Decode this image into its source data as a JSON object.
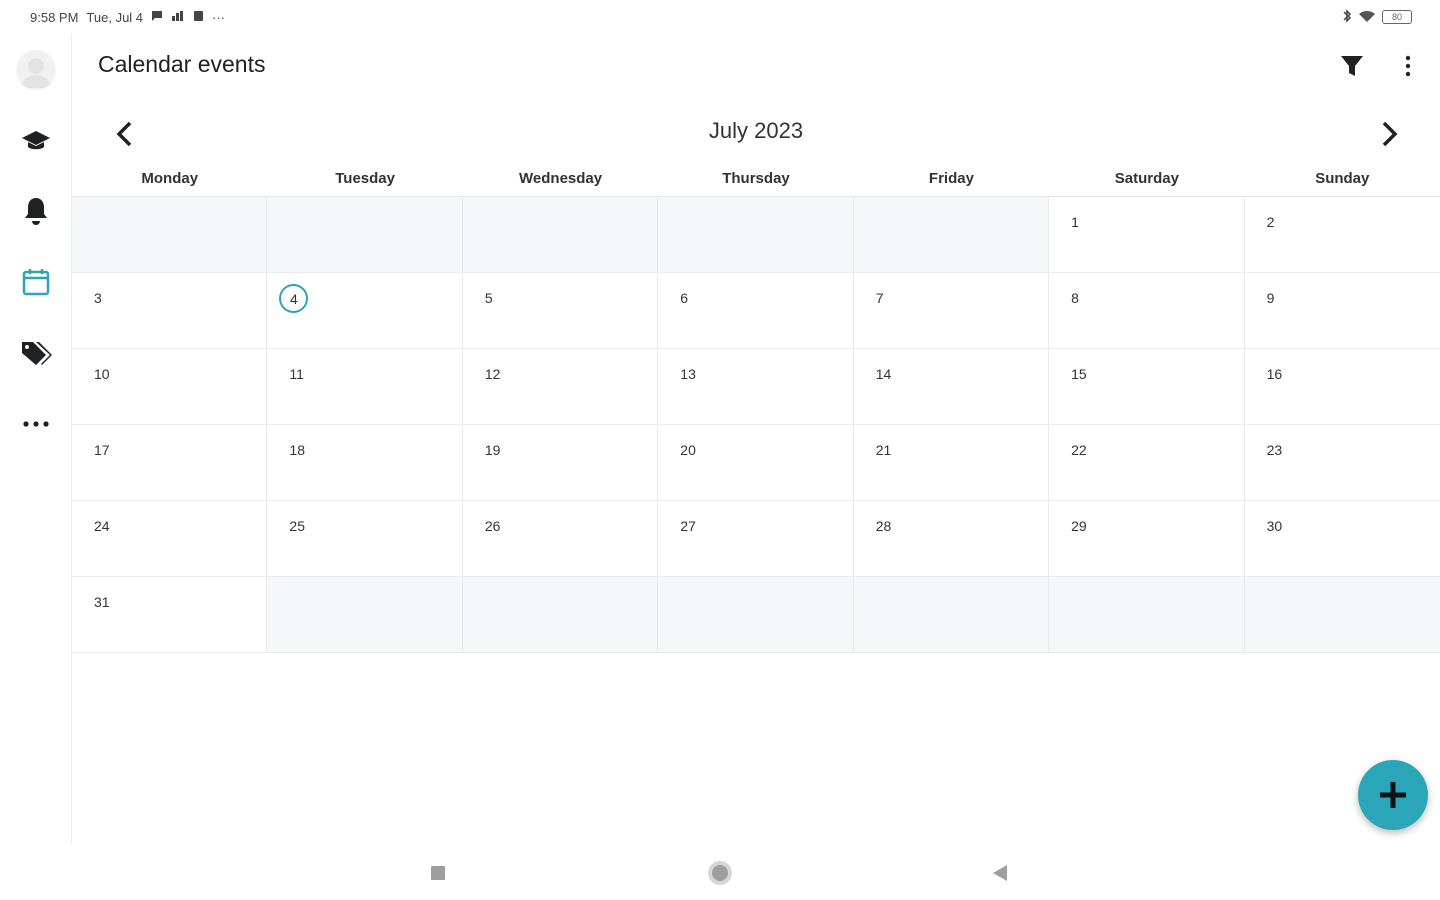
{
  "status_bar": {
    "time": "9:58 PM",
    "date": "Tue, Jul 4",
    "more": "···",
    "battery": "80"
  },
  "app": {
    "title": "Calendar events",
    "accent_color": "#2aa6b8"
  },
  "rail": {
    "items": [
      {
        "icon": "graduation-cap-icon"
      },
      {
        "icon": "bell-icon"
      },
      {
        "icon": "calendar-icon",
        "active": true
      },
      {
        "icon": "tags-icon"
      },
      {
        "icon": "more-horizontal-icon"
      }
    ]
  },
  "header": {
    "filter_icon": "filter-icon",
    "menu_icon": "more-vertical-icon"
  },
  "calendar": {
    "month_label": "July 2023",
    "weekdays": [
      "Monday",
      "Tuesday",
      "Wednesday",
      "Thursday",
      "Friday",
      "Saturday",
      "Sunday"
    ],
    "today": "4",
    "weeks": [
      [
        "",
        "",
        "",
        "",
        "",
        "1",
        "2"
      ],
      [
        "3",
        "4",
        "5",
        "6",
        "7",
        "8",
        "9"
      ],
      [
        "10",
        "11",
        "12",
        "13",
        "14",
        "15",
        "16"
      ],
      [
        "17",
        "18",
        "19",
        "20",
        "21",
        "22",
        "23"
      ],
      [
        "24",
        "25",
        "26",
        "27",
        "28",
        "29",
        "30"
      ],
      [
        "31",
        "",
        "",
        "",
        "",
        "",
        ""
      ]
    ]
  },
  "fab": {
    "icon": "plus-icon"
  },
  "system_nav": {
    "recents_icon": "recents-square-icon",
    "home_icon": "home-circle-icon",
    "back_icon": "back-triangle-icon"
  }
}
